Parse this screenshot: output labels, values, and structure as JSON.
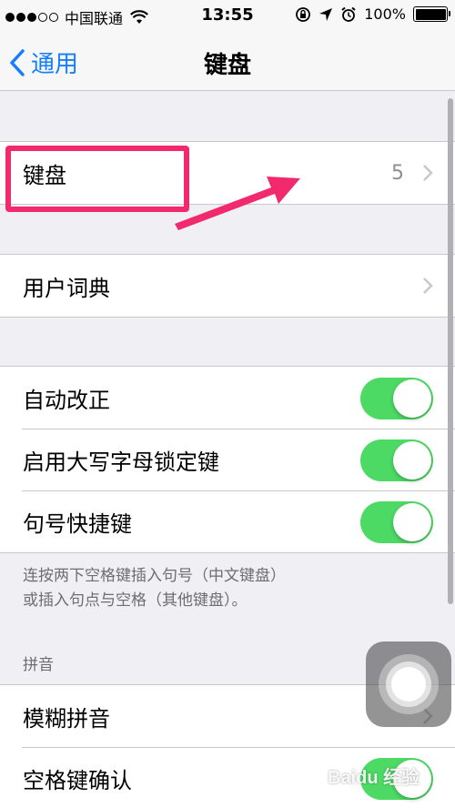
{
  "status_bar": {
    "carrier": "中国联通",
    "time": "13:55",
    "battery": "100%",
    "signal_bars_filled": 3,
    "signal_bars_total": 5
  },
  "nav": {
    "back_label": "通用",
    "title": "键盘"
  },
  "keyboard_row": {
    "label": "键盘",
    "value": "5"
  },
  "dictionary_row": {
    "label": "用户词典"
  },
  "toggles": [
    {
      "label": "自动改正",
      "on": true
    },
    {
      "label": "启用大写字母锁定键",
      "on": true
    },
    {
      "label": "句号快捷键",
      "on": true
    }
  ],
  "footer_note": {
    "line1": "连按两下空格键插入句号（中文键盘）",
    "line2": "或插入句点与空格（其他键盘）。"
  },
  "pinyin_section": {
    "header": "拼音",
    "fuzzy_label": "模糊拼音",
    "space_confirm_label": "空格键确认",
    "space_confirm_on": true
  },
  "watermark": "Baidu 经验",
  "colors": {
    "accent": "#157efb",
    "switch_on": "#4cd964",
    "annotation": "#f2296c"
  }
}
